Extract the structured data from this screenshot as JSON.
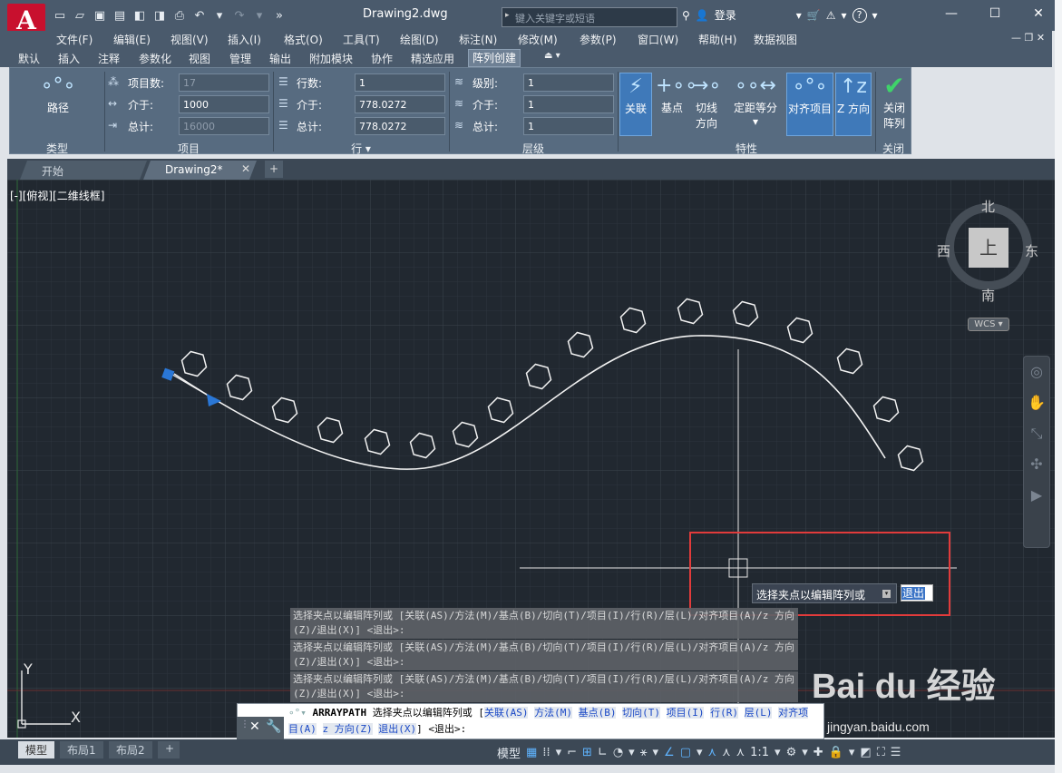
{
  "app": {
    "logo": "A",
    "title": "Drawing2.dwg"
  },
  "quick_access": [
    "new-icon",
    "open-icon",
    "save-icon",
    "saveas-icon",
    "web-save-icon",
    "share-icon",
    "print-icon",
    "undo-icon",
    "redo-icon",
    "more-icon"
  ],
  "search": {
    "placeholder": "键入关键字或短语"
  },
  "user": {
    "login": "登录"
  },
  "menus": [
    "文件(F)",
    "编辑(E)",
    "视图(V)",
    "插入(I)",
    "格式(O)",
    "工具(T)",
    "绘图(D)",
    "标注(N)",
    "修改(M)",
    "参数(P)",
    "窗口(W)",
    "帮助(H)",
    "数据视图"
  ],
  "ribbon_tabs": [
    "默认",
    "插入",
    "注释",
    "参数化",
    "视图",
    "管理",
    "输出",
    "附加模块",
    "协作",
    "精选应用",
    "阵列创建"
  ],
  "active_tab": "阵列创建",
  "ribbon": {
    "type_panel": {
      "button": "路径",
      "title": "类型"
    },
    "items_panel": {
      "title": "项目",
      "count_label": "项目数:",
      "count_value": "17",
      "between_label": "介于:",
      "between_value": "1000",
      "total_label": "总计:",
      "total_value": "16000"
    },
    "rows_panel": {
      "title": "行",
      "rows_label": "行数:",
      "rows_value": "1",
      "between_label": "介于:",
      "between_value": "778.0272",
      "total_label": "总计:",
      "total_value": "778.0272"
    },
    "levels_panel": {
      "title": "层级",
      "levels_label": "级别:",
      "levels_value": "1",
      "between_label": "介于:",
      "between_value": "1",
      "total_label": "总计:",
      "total_value": "1"
    },
    "props_panel": {
      "title": "特性",
      "associative": "关联",
      "base_point": "基点",
      "tangent_l1": "切线",
      "tangent_l2": "方向",
      "measure": "定距等分",
      "align": "对齐项目",
      "z_dir": "Z 方向"
    },
    "close_panel": {
      "title": "关闭",
      "close_l1": "关闭",
      "close_l2": "阵列"
    }
  },
  "file_tabs": {
    "start": "开始",
    "drawing": "Drawing2*"
  },
  "viewport": {
    "label": "[-][俯视][二维线框]"
  },
  "viewcube": {
    "north": "北",
    "south": "南",
    "east": "东",
    "west": "西",
    "top": "上",
    "wcs": "WCS"
  },
  "prompt": {
    "text": "选择夹点以编辑阵列或",
    "exit": "退出"
  },
  "history": [
    "选择夹点以编辑阵列或 [关联(AS)/方法(M)/基点(B)/切向(T)/项目(I)/行(R)/层(L)/对齐项目(A)/z 方向(Z)/退出(X)] <退出>:",
    "选择夹点以编辑阵列或 [关联(AS)/方法(M)/基点(B)/切向(T)/项目(I)/行(R)/层(L)/对齐项目(A)/z 方向(Z)/退出(X)] <退出>:",
    "选择夹点以编辑阵列或 [关联(AS)/方法(M)/基点(B)/切向(T)/项目(I)/行(R)/层(L)/对齐项目(A)/z 方向(Z)/退出(X)] <退出>:"
  ],
  "command": {
    "name": "ARRAYPATH",
    "prompt": "选择夹点以编辑阵列或 [",
    "options": [
      "关联(AS)",
      "方法(M)",
      "基点(B)",
      "切向(T)",
      "项目(I)",
      "行(R)",
      "层(L)",
      "对齐项目(A)",
      "z 方向(Z)",
      "退出(X)"
    ],
    "tail": "] <退出>:"
  },
  "layout_tabs": {
    "model": "模型",
    "layout1": "布局1",
    "layout2": "布局2"
  },
  "status": {
    "model": "模型",
    "scale": "1:1"
  },
  "axes": {
    "y": "Y",
    "x": "X"
  },
  "watermark": {
    "brand": "Bai du 经验",
    "url": "jingyan.baidu.com"
  }
}
